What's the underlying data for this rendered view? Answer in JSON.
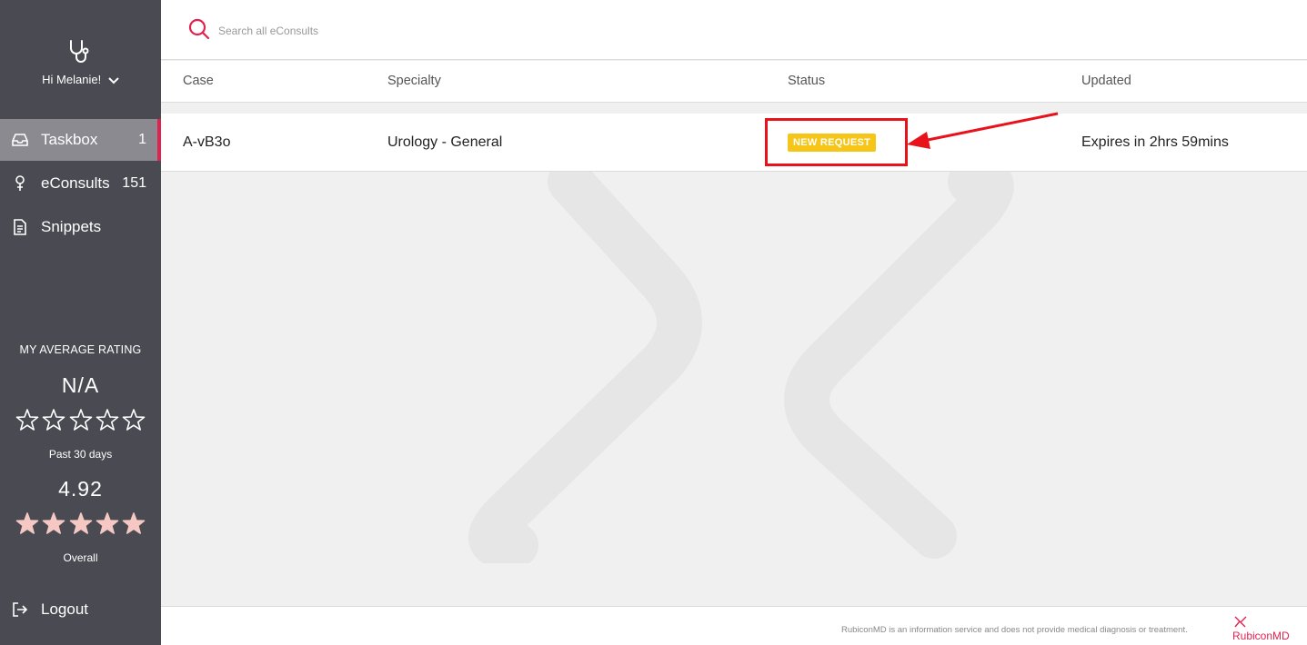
{
  "sidebar": {
    "greeting": "Hi Melanie!",
    "nav": [
      {
        "label": "Taskbox",
        "count": "1",
        "icon": "inbox-icon"
      },
      {
        "label": "eConsults",
        "count": "151",
        "icon": "stethoscope-icon"
      },
      {
        "label": "Snippets",
        "count": "",
        "icon": "document-icon"
      }
    ],
    "rating": {
      "title": "MY AVERAGE RATING",
      "recent_value": "N/A",
      "recent_stars_filled": 0,
      "recent_period": "Past 30 days",
      "overall_value": "4.92",
      "overall_stars_filled": 5,
      "overall_label": "Overall"
    },
    "logout": "Logout"
  },
  "search": {
    "placeholder": "Search all eConsults"
  },
  "table": {
    "columns": [
      "Case",
      "Specialty",
      "Status",
      "Updated"
    ],
    "rows": [
      {
        "case": "A-vB3o",
        "specialty": "Urology - General",
        "status": "NEW REQUEST",
        "updated": "Expires in 2hrs 59mins"
      }
    ]
  },
  "footer": {
    "disclaimer": "RubiconMD is an information service and does not provide medical diagnosis or treatment.",
    "brand": "RubiconMD"
  },
  "colors": {
    "sidebar_bg": "#4a4a52",
    "active_item_bg": "#8a8a90",
    "accent": "#e0234e",
    "badge": "#f5c518",
    "annotation": "#e8121a",
    "star": "#f6c8c4"
  }
}
